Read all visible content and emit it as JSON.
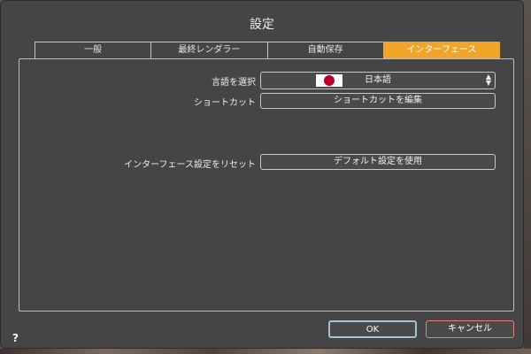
{
  "window": {
    "title": "設定"
  },
  "tabs": [
    {
      "label": "一般",
      "active": false
    },
    {
      "label": "最終レンダラー",
      "active": false
    },
    {
      "label": "自動保存",
      "active": false
    },
    {
      "label": "インターフェース",
      "active": true
    }
  ],
  "interface": {
    "language_label": "言語を選択",
    "language_value": "日本語",
    "language_flag": "japan-flag",
    "shortcut_label": "ショートカット",
    "shortcut_button": "ショートカットを編集",
    "reset_label": "インターフェース設定をリセット",
    "reset_button": "デフォルト設定を使用"
  },
  "footer": {
    "ok": "OK",
    "cancel": "キャンセル",
    "help": "?"
  },
  "colors": {
    "accent": "#f2a428",
    "ok_border": "#9fc4d6",
    "cancel_border": "#e28080"
  }
}
